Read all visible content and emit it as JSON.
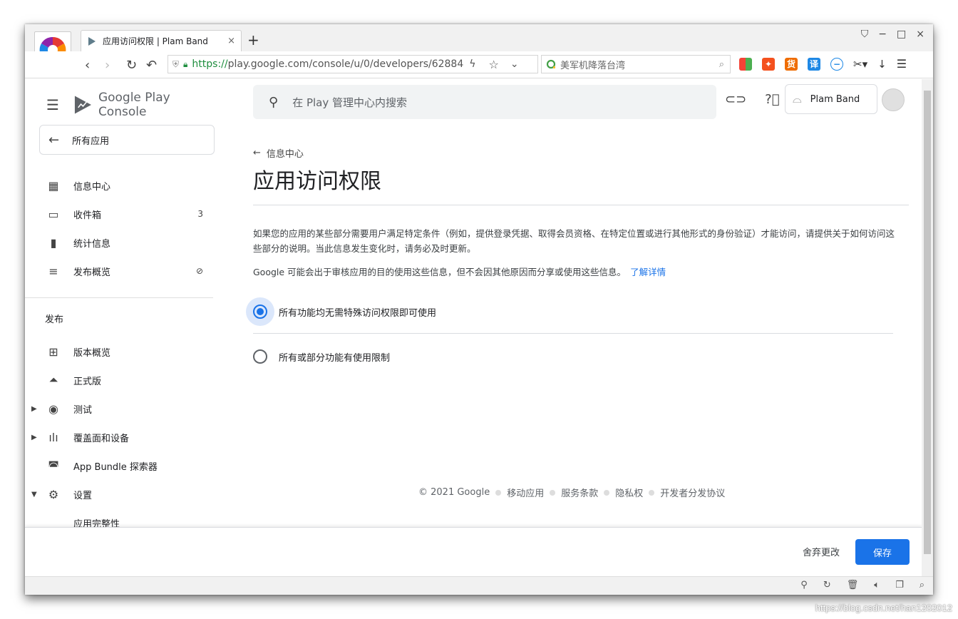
{
  "browser": {
    "tab_title": "应用访问权限 | Plam Band",
    "tab_close": "×",
    "new_tab": "+",
    "url_scheme": "https://",
    "url_rest": "play.google.com/console/u/0/developers/62884",
    "search_box": "美军机降落台湾",
    "ext_labels": [
      "货",
      "译"
    ],
    "win_controls": [
      "−",
      "□",
      "×"
    ]
  },
  "sidebar": {
    "brand": "Google Play Console",
    "all_apps": "所有应用",
    "items": [
      {
        "label": "信息中心",
        "icon": "dashboard-icon"
      },
      {
        "label": "收件箱",
        "icon": "inbox-icon",
        "badge": "3"
      },
      {
        "label": "统计信息",
        "icon": "stats-icon"
      },
      {
        "label": "发布概览",
        "icon": "publish-overview-icon"
      }
    ],
    "section_publish": "发布",
    "publish_items": [
      {
        "label": "版本概览",
        "icon": "release-overview-icon"
      },
      {
        "label": "正式版",
        "icon": "production-icon"
      },
      {
        "label": "测试",
        "icon": "testing-icon"
      },
      {
        "label": "覆盖面和设备",
        "icon": "reach-devices-icon"
      },
      {
        "label": "App Bundle 探索器",
        "icon": "app-bundle-icon"
      },
      {
        "label": "设置",
        "icon": "settings-icon"
      },
      {
        "label": "应用完整性",
        "icon": ""
      }
    ]
  },
  "header": {
    "search_placeholder": "在 Play 管理中心内搜索",
    "developer_name": "Plam Band"
  },
  "main": {
    "back_label": "信息中心",
    "title": "应用访问权限",
    "desc1": "如果您的应用的某些部分需要用户满足特定条件（例如，提供登录凭据、取得会员资格、在特定位置或进行其他形式的身份验证）才能访问，请提供关于如何访问这些部分的说明。当此信息发生变化时，请务必及时更新。",
    "desc2": "Google 可能会出于审核应用的目的使用这些信息，但不会因其他原因而分享或使用这些信息。",
    "learn_more": "了解详情",
    "radio1": "所有功能均无需特殊访问权限即可使用",
    "radio2": "所有或部分功能有使用限制",
    "radio_selected": 1
  },
  "footer": {
    "copyright": "© 2021 Google",
    "links": [
      "移动应用",
      "服务条款",
      "隐私权",
      "开发者分发协议"
    ]
  },
  "actions": {
    "discard": "舍弃更改",
    "save": "保存"
  },
  "watermark": "https://blog.csdn.net/han1202012",
  "colors": {
    "accent": "#1a73e8",
    "secure_green": "#1e8e3e"
  }
}
